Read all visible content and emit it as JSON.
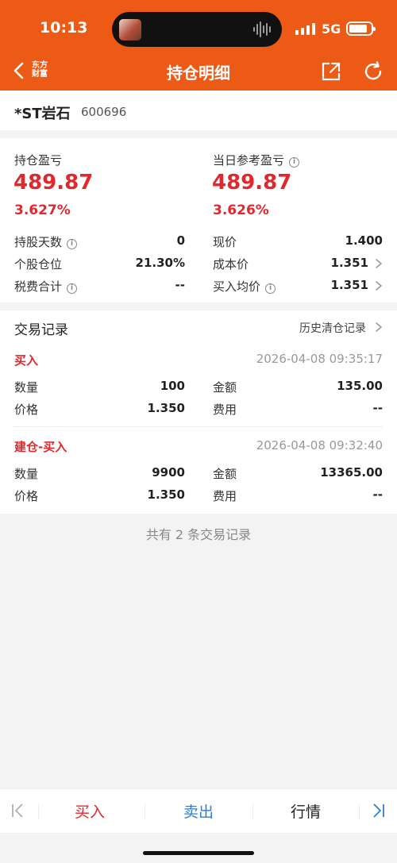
{
  "status": {
    "time": "10:13",
    "network": "5G"
  },
  "header": {
    "logo_text": "东方财富",
    "title": "持仓明细"
  },
  "stock": {
    "name": "*ST岩石",
    "code": "600696"
  },
  "summary": {
    "pnl_label": "持仓盈亏",
    "pnl_value": "489.87",
    "pnl_pct": "3.627%",
    "daily_label": "当日参考盈亏",
    "daily_value": "489.87",
    "daily_pct": "3.626%",
    "hold_days_label": "持股天数",
    "hold_days_value": "0",
    "position_label": "个股仓位",
    "position_value": "21.30%",
    "fee_label": "税费合计",
    "fee_value": "--",
    "price_label": "现价",
    "price_value": "1.400",
    "cost_label": "成本价",
    "cost_value": "1.351",
    "avg_label": "买入均价",
    "avg_value": "1.351"
  },
  "trades": {
    "title": "交易记录",
    "history_link": "历史清仓记录",
    "records": [
      {
        "type": "买入",
        "time": "2026-04-08 09:35:17",
        "qty_label": "数量",
        "qty": "100",
        "amount_label": "金额",
        "amount": "135.00",
        "price_label": "价格",
        "price": "1.350",
        "fee_label": "费用",
        "fee": "--"
      },
      {
        "type": "建仓-买入",
        "time": "2026-04-08 09:32:40",
        "qty_label": "数量",
        "qty": "9900",
        "amount_label": "金额",
        "amount": "13365.00",
        "price_label": "价格",
        "price": "1.350",
        "fee_label": "费用",
        "fee": "--"
      }
    ],
    "total_text": "共有 2 条交易记录"
  },
  "bottom_bar": {
    "buy": "买入",
    "sell": "卖出",
    "quote": "行情"
  },
  "colors": {
    "brand": "#ec5a15",
    "up": "#e0282d",
    "sell": "#2a7fd6"
  }
}
